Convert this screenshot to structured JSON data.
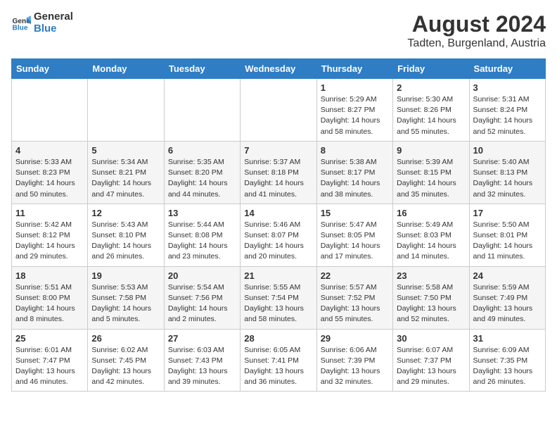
{
  "logo": {
    "line1": "General",
    "line2": "Blue"
  },
  "title": "August 2024",
  "subtitle": "Tadten, Burgenland, Austria",
  "weekdays": [
    "Sunday",
    "Monday",
    "Tuesday",
    "Wednesday",
    "Thursday",
    "Friday",
    "Saturday"
  ],
  "weeks": [
    [
      {
        "day": "",
        "info": ""
      },
      {
        "day": "",
        "info": ""
      },
      {
        "day": "",
        "info": ""
      },
      {
        "day": "",
        "info": ""
      },
      {
        "day": "1",
        "info": "Sunrise: 5:29 AM\nSunset: 8:27 PM\nDaylight: 14 hours\nand 58 minutes."
      },
      {
        "day": "2",
        "info": "Sunrise: 5:30 AM\nSunset: 8:26 PM\nDaylight: 14 hours\nand 55 minutes."
      },
      {
        "day": "3",
        "info": "Sunrise: 5:31 AM\nSunset: 8:24 PM\nDaylight: 14 hours\nand 52 minutes."
      }
    ],
    [
      {
        "day": "4",
        "info": "Sunrise: 5:33 AM\nSunset: 8:23 PM\nDaylight: 14 hours\nand 50 minutes."
      },
      {
        "day": "5",
        "info": "Sunrise: 5:34 AM\nSunset: 8:21 PM\nDaylight: 14 hours\nand 47 minutes."
      },
      {
        "day": "6",
        "info": "Sunrise: 5:35 AM\nSunset: 8:20 PM\nDaylight: 14 hours\nand 44 minutes."
      },
      {
        "day": "7",
        "info": "Sunrise: 5:37 AM\nSunset: 8:18 PM\nDaylight: 14 hours\nand 41 minutes."
      },
      {
        "day": "8",
        "info": "Sunrise: 5:38 AM\nSunset: 8:17 PM\nDaylight: 14 hours\nand 38 minutes."
      },
      {
        "day": "9",
        "info": "Sunrise: 5:39 AM\nSunset: 8:15 PM\nDaylight: 14 hours\nand 35 minutes."
      },
      {
        "day": "10",
        "info": "Sunrise: 5:40 AM\nSunset: 8:13 PM\nDaylight: 14 hours\nand 32 minutes."
      }
    ],
    [
      {
        "day": "11",
        "info": "Sunrise: 5:42 AM\nSunset: 8:12 PM\nDaylight: 14 hours\nand 29 minutes."
      },
      {
        "day": "12",
        "info": "Sunrise: 5:43 AM\nSunset: 8:10 PM\nDaylight: 14 hours\nand 26 minutes."
      },
      {
        "day": "13",
        "info": "Sunrise: 5:44 AM\nSunset: 8:08 PM\nDaylight: 14 hours\nand 23 minutes."
      },
      {
        "day": "14",
        "info": "Sunrise: 5:46 AM\nSunset: 8:07 PM\nDaylight: 14 hours\nand 20 minutes."
      },
      {
        "day": "15",
        "info": "Sunrise: 5:47 AM\nSunset: 8:05 PM\nDaylight: 14 hours\nand 17 minutes."
      },
      {
        "day": "16",
        "info": "Sunrise: 5:49 AM\nSunset: 8:03 PM\nDaylight: 14 hours\nand 14 minutes."
      },
      {
        "day": "17",
        "info": "Sunrise: 5:50 AM\nSunset: 8:01 PM\nDaylight: 14 hours\nand 11 minutes."
      }
    ],
    [
      {
        "day": "18",
        "info": "Sunrise: 5:51 AM\nSunset: 8:00 PM\nDaylight: 14 hours\nand 8 minutes."
      },
      {
        "day": "19",
        "info": "Sunrise: 5:53 AM\nSunset: 7:58 PM\nDaylight: 14 hours\nand 5 minutes."
      },
      {
        "day": "20",
        "info": "Sunrise: 5:54 AM\nSunset: 7:56 PM\nDaylight: 14 hours\nand 2 minutes."
      },
      {
        "day": "21",
        "info": "Sunrise: 5:55 AM\nSunset: 7:54 PM\nDaylight: 13 hours\nand 58 minutes."
      },
      {
        "day": "22",
        "info": "Sunrise: 5:57 AM\nSunset: 7:52 PM\nDaylight: 13 hours\nand 55 minutes."
      },
      {
        "day": "23",
        "info": "Sunrise: 5:58 AM\nSunset: 7:50 PM\nDaylight: 13 hours\nand 52 minutes."
      },
      {
        "day": "24",
        "info": "Sunrise: 5:59 AM\nSunset: 7:49 PM\nDaylight: 13 hours\nand 49 minutes."
      }
    ],
    [
      {
        "day": "25",
        "info": "Sunrise: 6:01 AM\nSunset: 7:47 PM\nDaylight: 13 hours\nand 46 minutes."
      },
      {
        "day": "26",
        "info": "Sunrise: 6:02 AM\nSunset: 7:45 PM\nDaylight: 13 hours\nand 42 minutes."
      },
      {
        "day": "27",
        "info": "Sunrise: 6:03 AM\nSunset: 7:43 PM\nDaylight: 13 hours\nand 39 minutes."
      },
      {
        "day": "28",
        "info": "Sunrise: 6:05 AM\nSunset: 7:41 PM\nDaylight: 13 hours\nand 36 minutes."
      },
      {
        "day": "29",
        "info": "Sunrise: 6:06 AM\nSunset: 7:39 PM\nDaylight: 13 hours\nand 32 minutes."
      },
      {
        "day": "30",
        "info": "Sunrise: 6:07 AM\nSunset: 7:37 PM\nDaylight: 13 hours\nand 29 minutes."
      },
      {
        "day": "31",
        "info": "Sunrise: 6:09 AM\nSunset: 7:35 PM\nDaylight: 13 hours\nand 26 minutes."
      }
    ]
  ]
}
